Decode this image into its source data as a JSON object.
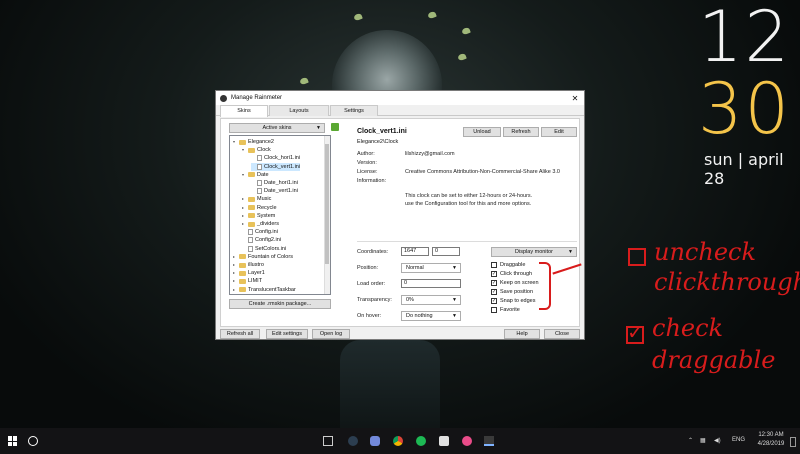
{
  "clock": {
    "hour": "12",
    "minute": "30",
    "date": "sun | april 28"
  },
  "window": {
    "title": "Manage Rainmeter",
    "tabs": [
      "Skins",
      "Layouts",
      "Settings"
    ],
    "active_skins_label": "Active skins",
    "tree": [
      {
        "label": "Elegance2",
        "kind": "folder",
        "level": 0,
        "expanded": true
      },
      {
        "label": "Clock",
        "kind": "folder",
        "level": 1,
        "expanded": true
      },
      {
        "label": "Clock_hori1.ini",
        "kind": "file",
        "level": 2
      },
      {
        "label": "Clock_vert1.ini",
        "kind": "file",
        "level": 2,
        "selected": true
      },
      {
        "label": "Date",
        "kind": "folder",
        "level": 1,
        "expanded": true
      },
      {
        "label": "Date_hori1.ini",
        "kind": "file",
        "level": 2
      },
      {
        "label": "Date_vert1.ini",
        "kind": "file",
        "level": 2
      },
      {
        "label": "Music",
        "kind": "folder",
        "level": 1
      },
      {
        "label": "Recycle",
        "kind": "folder",
        "level": 1
      },
      {
        "label": "System",
        "kind": "folder",
        "level": 1
      },
      {
        "label": "_dividers",
        "kind": "folder",
        "level": 1
      },
      {
        "label": "Config.ini",
        "kind": "file",
        "level": 1
      },
      {
        "label": "Config2.ini",
        "kind": "file",
        "level": 1
      },
      {
        "label": "SetColors.ini",
        "kind": "file",
        "level": 1
      },
      {
        "label": "Fountain of Colors",
        "kind": "folder",
        "level": 0
      },
      {
        "label": "illustro",
        "kind": "folder",
        "level": 0
      },
      {
        "label": "Layer1",
        "kind": "folder",
        "level": 0
      },
      {
        "label": "LIMIT",
        "kind": "folder",
        "level": 0
      },
      {
        "label": "TranslucentTaskbar",
        "kind": "folder",
        "level": 0
      }
    ],
    "create_package_label": "Create .rmskin package...",
    "skin_name": "Clock_vert1.ini",
    "skin_path": "Elegance2\\Clock",
    "buttons": {
      "unload": "Unload",
      "refresh": "Refresh",
      "edit": "Edit"
    },
    "info": {
      "author_label": "Author:",
      "author": "lilshizzy@gmail.com",
      "version_label": "Version:",
      "version": "",
      "license_label": "License:",
      "license": "Creative Commons Attribution-Non-Commercial-Share Alike 3.0",
      "information_label": "Information:",
      "information_line1": "This clock can be set to either 12-hours or 24-hours.",
      "information_line2": "use the Configuration tool for this and more options."
    },
    "settings": {
      "coordinates_label": "Coordinates:",
      "coord_x": "1647",
      "coord_y": "0",
      "position_label": "Position:",
      "position": "Normal",
      "load_order_label": "Load order:",
      "load_order": "0",
      "transparency_label": "Transparency:",
      "transparency": "0%",
      "on_hover_label": "On hover:",
      "on_hover": "Do nothing",
      "display_monitor": "Display monitor"
    },
    "checkboxes": [
      {
        "label": "Draggable",
        "checked": false
      },
      {
        "label": "Click through",
        "checked": true
      },
      {
        "label": "Keep on screen",
        "checked": true
      },
      {
        "label": "Save position",
        "checked": true
      },
      {
        "label": "Snap to edges",
        "checked": true
      },
      {
        "label": "Favorite",
        "checked": false
      }
    ],
    "footer": {
      "refresh_all": "Refresh all",
      "edit_settings": "Edit settings",
      "open_log": "Open log",
      "help": "Help",
      "close": "Close"
    }
  },
  "annotations": {
    "note1_line1": "uncheck",
    "note1_line2": "clickthrough",
    "note2_line1": "check",
    "note2_line2": "draggable",
    "color": "#d81c1c"
  },
  "taskbar": {
    "time": "12:30 AM",
    "date": "4/28/2019",
    "lang": "ENG"
  }
}
